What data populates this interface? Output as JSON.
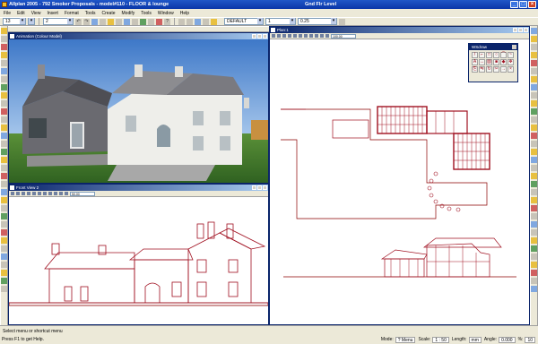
{
  "window": {
    "title": "Allplan 2005 - 792 Smoker Proposals - model#110 - FLOOR & lounge",
    "layer": "Gnd Flr Level"
  },
  "menu": [
    "File",
    "Edit",
    "View",
    "Insert",
    "Format",
    "Tools",
    "Create",
    "Modify",
    "Tools",
    "Window",
    "Help"
  ],
  "toolbar": {
    "pen_value": "13",
    "line_value": "2",
    "layer_value": "DEFAULT",
    "number_value": "1",
    "thickness_value": "0.25"
  },
  "panes": {
    "animation": {
      "title": "Animation (Colour Model)"
    },
    "front": {
      "title": "Front View 2",
      "zoom": "50.00"
    },
    "plan": {
      "title": "Plan:1",
      "zoom": "100.00"
    }
  },
  "palette": {
    "title": "WSdraw",
    "icons": [
      "line",
      "polyline",
      "rectangle",
      "circle",
      "arc",
      "spline",
      "text",
      "dimension",
      "hatch",
      "fill",
      "symbol",
      "move",
      "copy",
      "mirror",
      "rotate",
      "trim",
      "extend",
      "delete"
    ]
  },
  "status": {
    "prompt": "Select menu or shortcut menu",
    "hint": "Press F1 to get Help.",
    "mode_label": "Mode:",
    "mode_value": "? Menu",
    "scale_label": "Scale:",
    "scale_value": "1 : 50",
    "length_label": "Length:",
    "length_value": "mm",
    "angle_label": "Angle:",
    "angle_value": "0.000",
    "deg_label": "%:",
    "deg_value": "10"
  },
  "colors": {
    "accent": "#0a246a",
    "drawing_red": "#a01020",
    "sky": "#6fa0d8",
    "grass": "#4a8030"
  }
}
